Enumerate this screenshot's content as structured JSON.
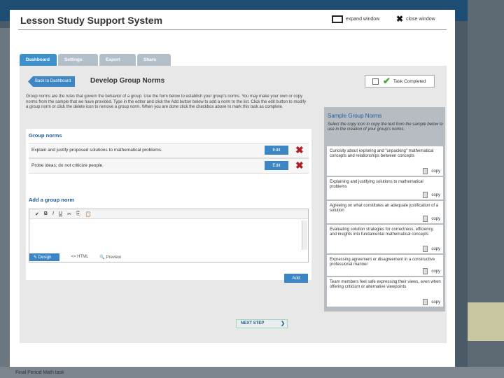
{
  "window": {
    "title": "Lesson Study Support System",
    "expand_label": "expand window",
    "close_label": "close window"
  },
  "tabs": [
    {
      "label": "Dashboard",
      "active": true
    },
    {
      "label": "Settings",
      "active": false
    },
    {
      "label": "Export",
      "active": false
    },
    {
      "label": "Share",
      "active": false
    }
  ],
  "header": {
    "back_label": "Back to Dashboard",
    "heading": "Develop Group Norms",
    "task_label": "Task Completed"
  },
  "intro": "Group norms are the rules that govern the behavior of a group. Use the form below to establish your group's norms. You may make your own or copy norms from the sample that we have provided. Type in the editor and click the Add button below to add a norm to the list. Click the edit button to modify a group norm or click the delete icon to remove a group norm. When you are done click the checkbox above to mark this task as complete.",
  "norms": {
    "heading": "Group norms",
    "edit_label": "Edit",
    "items": [
      {
        "text": "Explain and justify proposed solutions to mathematical problems."
      },
      {
        "text": "Probe ideas; do not criticize people."
      }
    ]
  },
  "add_norm": {
    "heading": "Add a group norm",
    "toolbar": [
      "✔",
      "B",
      "I",
      "U",
      "✂",
      "⎘",
      "📋"
    ],
    "modes": [
      "Design",
      "HTML",
      "Preview"
    ],
    "add_label": "Add"
  },
  "sample": {
    "heading": "Sample Group Norms",
    "description": "Select the copy icon to copy the text from the sample below to use in the creation of your group's norms.",
    "copy_label": "copy",
    "items": [
      {
        "text": "Curiosity about exploring and \"unpacking\" mathematical concepts and relationships between concepts"
      },
      {
        "text": "Explaining and justifying solutions to mathematical problems"
      },
      {
        "text": "Agreeing on what constitutes an adequate justification of a solution"
      },
      {
        "text": "Evaluating solution strategies for correctness, efficiency, and insights into fundamental mathematical concepts"
      },
      {
        "text": "Expressing agreement or disagreement in a constructive professional manner"
      },
      {
        "text": "Team members feel safe expressing their views, even when offering criticism or alternative viewpoints"
      }
    ]
  },
  "next_label": "NEXT STEP",
  "background": {
    "bottom_text": "Final Period Math task"
  }
}
